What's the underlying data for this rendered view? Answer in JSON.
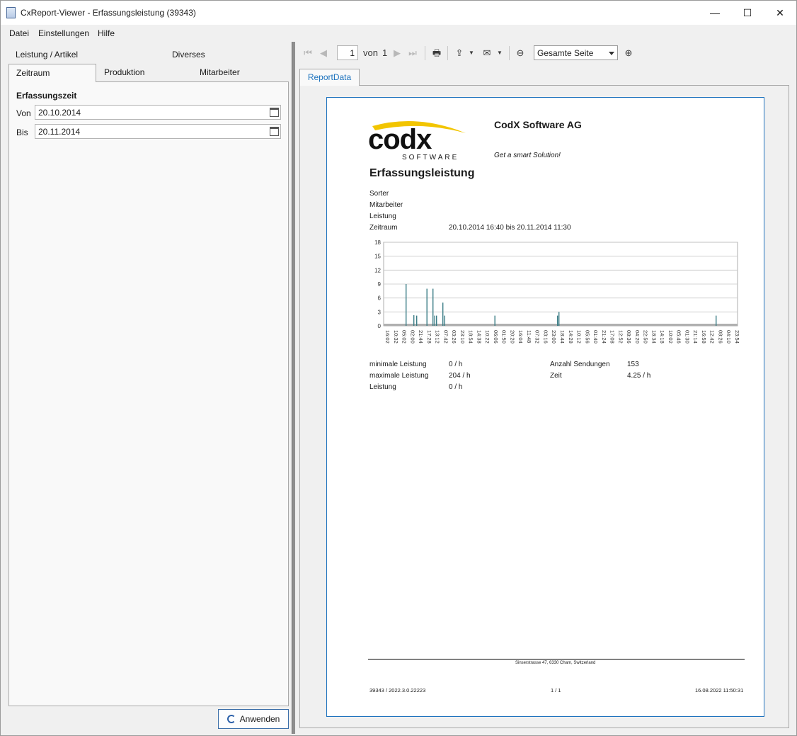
{
  "window": {
    "title": "CxReport-Viewer - Erfassungsleistung (39343)",
    "minimize": "—",
    "maximize": "☐",
    "close": "✕"
  },
  "menu": [
    "Datei",
    "Einstellungen",
    "Hilfe"
  ],
  "left": {
    "tabs_row1": [
      "Leistung / Artikel",
      "Diverses"
    ],
    "tabs_row2": [
      "Zeitraum",
      "Produktion",
      "Mitarbeiter"
    ],
    "active_tab": "Zeitraum",
    "section_title": "Erfassungszeit",
    "from_label": "Von",
    "from_value": "20.10.2014",
    "to_label": "Bis",
    "to_value": "20.11.2014",
    "apply_button": "Anwenden"
  },
  "toolbar": {
    "page_value": "1",
    "of_label": "von",
    "total_pages": "1",
    "zoom_value": "Gesamte Seite"
  },
  "report_tab": "ReportData",
  "report": {
    "logo_text": "codx",
    "logo_sub": "SOFTWARE",
    "company": "CodX Software AG",
    "slogan": "Get a smart Solution!",
    "title": "Erfassungsleistung",
    "params": [
      {
        "label": "Sorter",
        "value": ""
      },
      {
        "label": "Mitarbeiter",
        "value": ""
      },
      {
        "label": "Leistung",
        "value": ""
      },
      {
        "label": "Zeitraum",
        "value": "20.10.2014 16:40 bis 20.11.2014 11:30"
      }
    ],
    "stats": {
      "min_label": "minimale Leistung",
      "min_value": "0 / h",
      "max_label": "maximale Leistung",
      "max_value": "204 / h",
      "perf_label": "Leistung",
      "perf_value": "0 / h",
      "count_label": "Anzahl Sendungen",
      "count_value": "153",
      "time_label": "Zeit",
      "time_value": "4.25 / h"
    },
    "address": "Sinserstrasse 47, 6330 Cham, Switzerland",
    "footer_left": "39343 / 2022.3.0.22223",
    "footer_center": "1 / 1",
    "footer_right": "16.08.2022 11:50:31"
  },
  "chart_data": {
    "type": "bar",
    "yticks": [
      0,
      3,
      6,
      9,
      12,
      15,
      18
    ],
    "ylim": [
      0,
      18
    ],
    "grid": true,
    "categories": [
      "16:02",
      "10:32",
      "05:02",
      "02:00",
      "21:44",
      "17:28",
      "13:12",
      "07:42",
      "03:26",
      "23:10",
      "18:54",
      "14:38",
      "10:22",
      "06:06",
      "01:50",
      "20:20",
      "16:04",
      "11:48",
      "07:32",
      "03:16",
      "23:00",
      "18:44",
      "14:28",
      "10:12",
      "05:56",
      "01:40",
      "21:24",
      "17:08",
      "12:52",
      "08:36",
      "04:20",
      "22:50",
      "18:34",
      "14:18",
      "10:02",
      "05:46",
      "01:30",
      "21:14",
      "16:58",
      "12:42",
      "08:26",
      "04:10",
      "23:54"
    ],
    "bars": [
      {
        "x": 0.062,
        "value": 9
      },
      {
        "x": 0.084,
        "value": 2.3
      },
      {
        "x": 0.092,
        "value": 2.2
      },
      {
        "x": 0.121,
        "value": 8
      },
      {
        "x": 0.138,
        "value": 8
      },
      {
        "x": 0.143,
        "value": 2.2
      },
      {
        "x": 0.148,
        "value": 2.2
      },
      {
        "x": 0.166,
        "value": 5
      },
      {
        "x": 0.171,
        "value": 2.2
      },
      {
        "x": 0.313,
        "value": 2.2
      },
      {
        "x": 0.49,
        "value": 2.2
      },
      {
        "x": 0.494,
        "value": 3
      },
      {
        "x": 0.938,
        "value": 2.2
      }
    ]
  }
}
